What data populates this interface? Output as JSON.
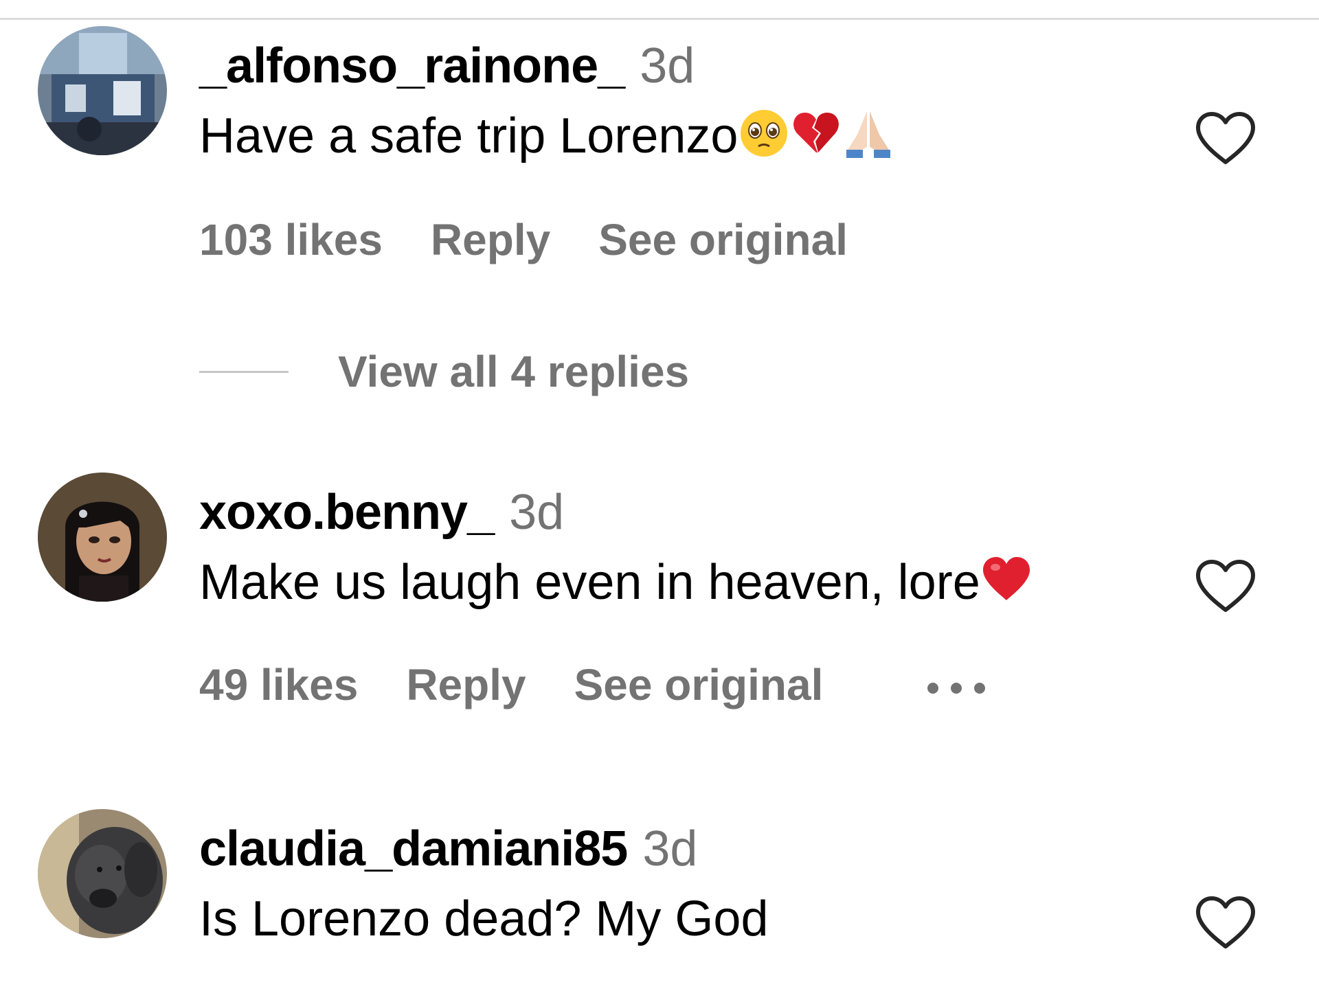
{
  "comments": [
    {
      "username": "_alfonso_rainone_",
      "time": "3d",
      "text": "Have a safe trip Lorenzo",
      "emojis": [
        "pleading-face",
        "broken-heart",
        "folded-hands"
      ],
      "likes": "103 likes",
      "reply_label": "Reply",
      "see_original_label": "See original",
      "view_replies_label": "View all 4 replies"
    },
    {
      "username": "xoxo.benny_",
      "time": "3d",
      "text": "Make us laugh even in heaven, lore",
      "emojis": [
        "red-heart"
      ],
      "likes": "49 likes",
      "reply_label": "Reply",
      "see_original_label": "See original",
      "more_label": "..."
    },
    {
      "username": "claudia_damiani85",
      "time": "3d",
      "text": "Is Lorenzo dead? My God"
    }
  ],
  "icons": {
    "like": "heart-outline-icon",
    "more": "more-options-icon"
  },
  "colors": {
    "text_primary": "#000000",
    "text_secondary": "#737373",
    "divider": "#dbdbdb",
    "heart_red": "#e0202f"
  }
}
